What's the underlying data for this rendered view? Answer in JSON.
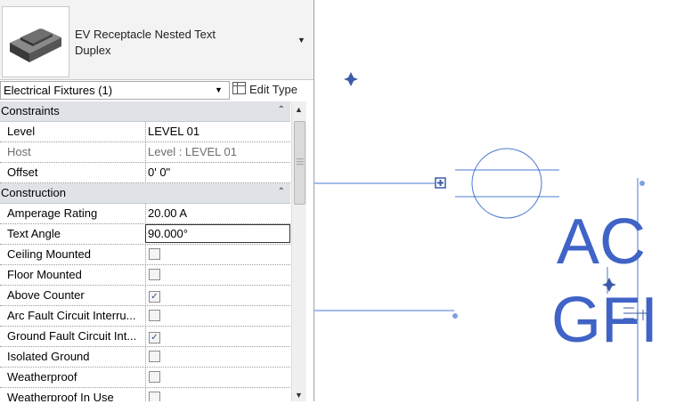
{
  "properties": {
    "type_name_line1": "EV Receptacle Nested Text",
    "type_name_line2": "Duplex",
    "category_filter": "Electrical Fixtures (1)",
    "edit_type_label": "Edit Type",
    "groups": {
      "constraints": "Constraints",
      "construction": "Construction"
    },
    "constraints": {
      "level_label": "Level",
      "level_value": "LEVEL 01",
      "host_label": "Host",
      "host_value": "Level : LEVEL 01",
      "offset_label": "Offset",
      "offset_value": "0'  0\""
    },
    "construction": {
      "amperage_label": "Amperage Rating",
      "amperage_value": "20.00 A",
      "text_angle_label": "Text Angle",
      "text_angle_value": "90.000°",
      "ceiling_label": "Ceiling Mounted",
      "ceiling_checked": false,
      "floor_label": "Floor Mounted",
      "floor_checked": false,
      "above_counter_label": "Above Counter",
      "above_counter_checked": true,
      "arc_fault_label": "Arc Fault Circuit Interru...",
      "arc_fault_checked": false,
      "gfci_label": "Ground Fault Circuit Int...",
      "gfci_checked": true,
      "isolated_label": "Isolated Ground",
      "isolated_checked": false,
      "weatherproof_label": "Weatherproof",
      "weatherproof_checked": false,
      "weatherproof_in_use_label": "Weatherproof In Use",
      "weatherproof_in_use_checked": false
    }
  },
  "canvas": {
    "tag_line1": "AC",
    "tag_line2": "GFI"
  },
  "colors": {
    "tag_text": "#3f63c6",
    "line": "#4a78d0",
    "group_bg": "#dfe3e8"
  },
  "icons": [
    "receptacle-thumbnail-icon",
    "dropdown-arrow-icon",
    "edit-type-icon",
    "collapse-chevron-icon",
    "checkmark-icon",
    "scroll-arrow-icon",
    "rotate-grip-icon",
    "move-grip-icon"
  ]
}
